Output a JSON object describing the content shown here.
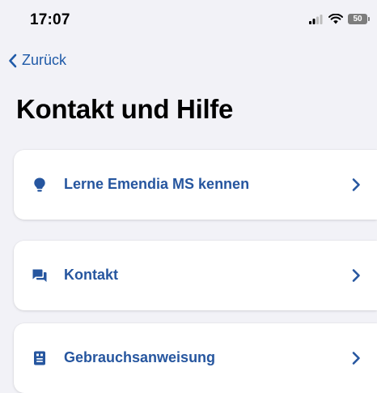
{
  "status_bar": {
    "time": "17:07",
    "battery_level": "50"
  },
  "nav": {
    "back_label": "Zurück"
  },
  "page": {
    "title": "Kontakt und Hilfe"
  },
  "menu": {
    "items": [
      {
        "label": "Lerne Emendia MS kennen",
        "icon": "lightbulb-icon"
      },
      {
        "label": "Kontakt",
        "icon": "chat-bubbles-icon"
      },
      {
        "label": "Gebrauchsanweisung",
        "icon": "manual-book-icon"
      }
    ]
  },
  "colors": {
    "accent": "#26569f",
    "background": "#f2f2f7",
    "card": "#ffffff"
  }
}
